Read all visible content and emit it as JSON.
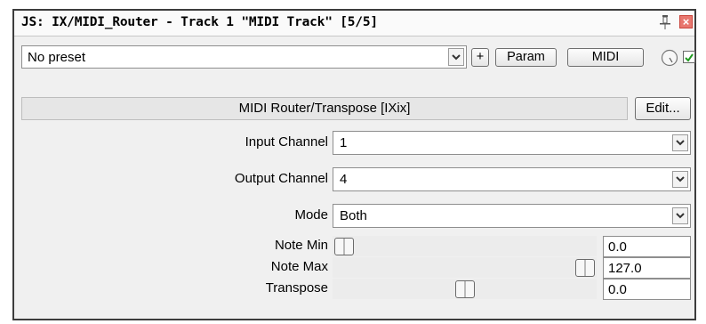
{
  "window": {
    "title": "JS: IX/MIDI_Router - Track 1 \"MIDI Track\" [5/5]",
    "close_glyph": "×"
  },
  "toolbar": {
    "preset_value": "No preset",
    "add_label": "+",
    "param_label": "Param",
    "midi_label": "MIDI",
    "enabled_checked": true
  },
  "plugin": {
    "name": "MIDI Router/Transpose [IXix]",
    "edit_label": "Edit..."
  },
  "params": {
    "input_channel": {
      "label": "Input Channel",
      "value": "1"
    },
    "output_channel": {
      "label": "Output Channel",
      "value": "4"
    },
    "mode": {
      "label": "Mode",
      "value": "Both"
    },
    "note_min": {
      "label": "Note Min",
      "value": "0.0",
      "fraction": 0.0
    },
    "note_max": {
      "label": "Note Max",
      "value": "127.0",
      "fraction": 1.0
    },
    "transpose": {
      "label": "Transpose",
      "value": "0.0",
      "fraction": 0.5
    }
  },
  "colors": {
    "close_button": "#e8776f",
    "check_mark": "#1f9a1f",
    "window_bg": "#f0f0f0"
  },
  "icons": [
    "pin-icon",
    "close-icon",
    "chevron-down-icon",
    "knob-icon",
    "checkmark-icon"
  ]
}
